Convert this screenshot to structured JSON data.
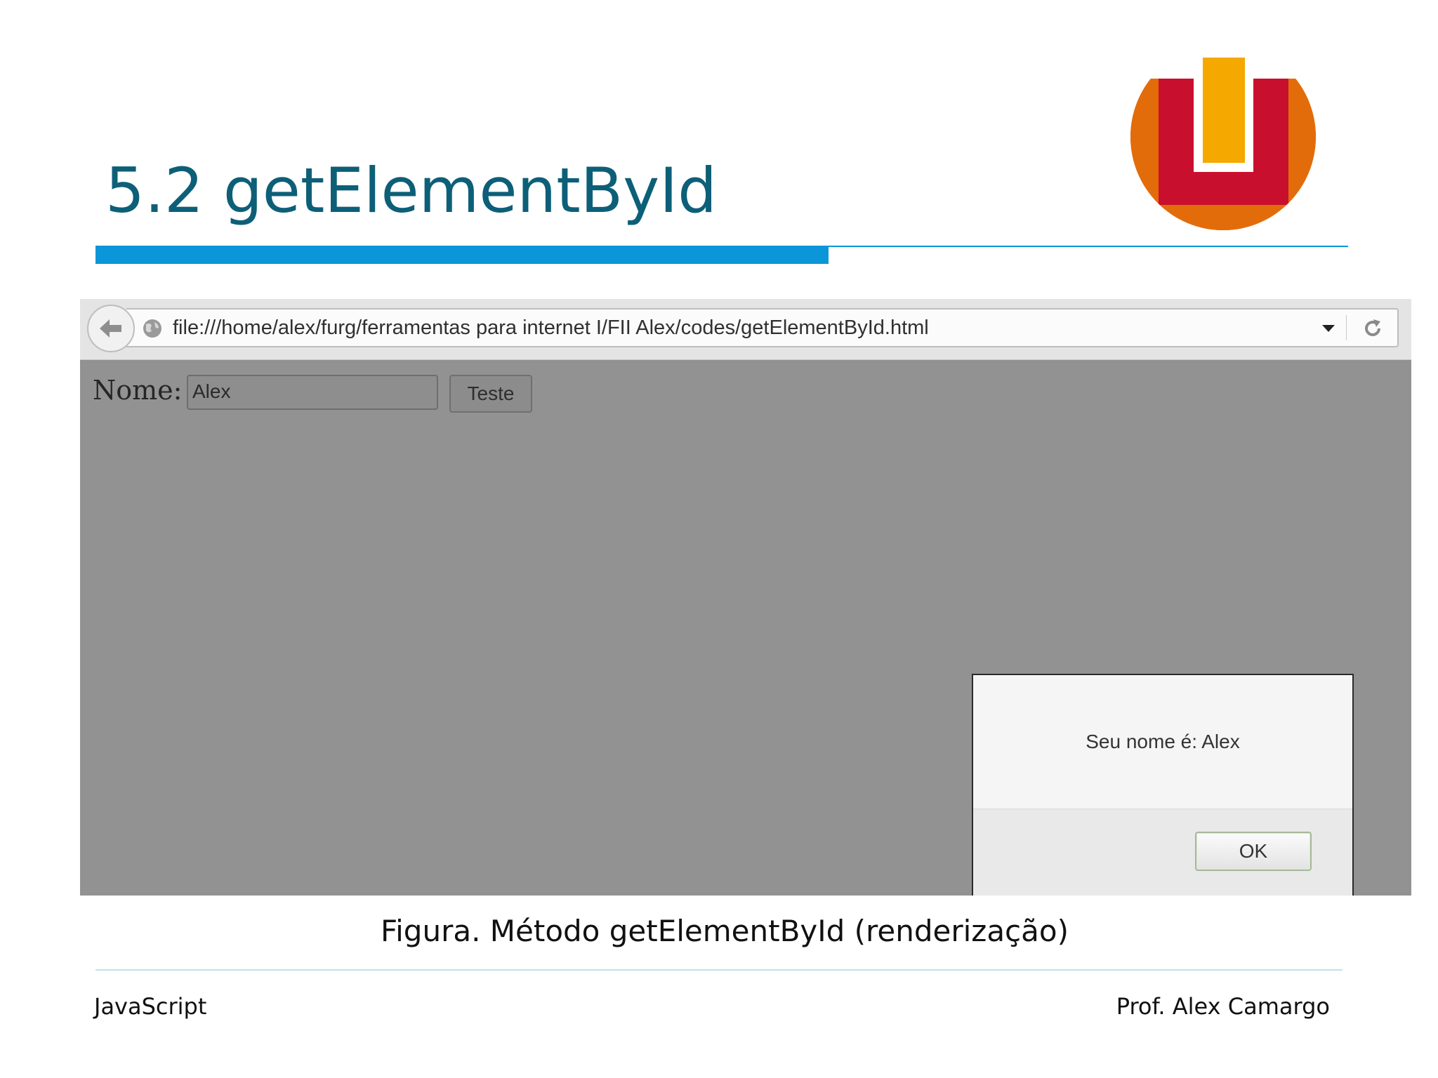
{
  "slide": {
    "title": "5.2 getElementById",
    "caption": "Figura. Método getElementById (renderização)",
    "footer_left": "JavaScript",
    "footer_right": "Prof. Alex Camargo",
    "accent_color": "#0a96d8",
    "title_color": "#0d5f78"
  },
  "browser": {
    "url": "file:///home/alex/furg/ferramentas para internet I/FII Alex/codes/getElementById.html",
    "icons": [
      "back-arrow-icon",
      "globe-icon",
      "dropdown-arrow-icon",
      "reload-icon"
    ]
  },
  "page": {
    "name_label": "Nome:",
    "name_value": "Alex",
    "button_label": "Teste"
  },
  "dialog": {
    "message": "Seu nome é: Alex",
    "ok_label": "OK"
  },
  "logo": {
    "colors": [
      "#f5a800",
      "#c8102e",
      "#e36c0a"
    ]
  }
}
